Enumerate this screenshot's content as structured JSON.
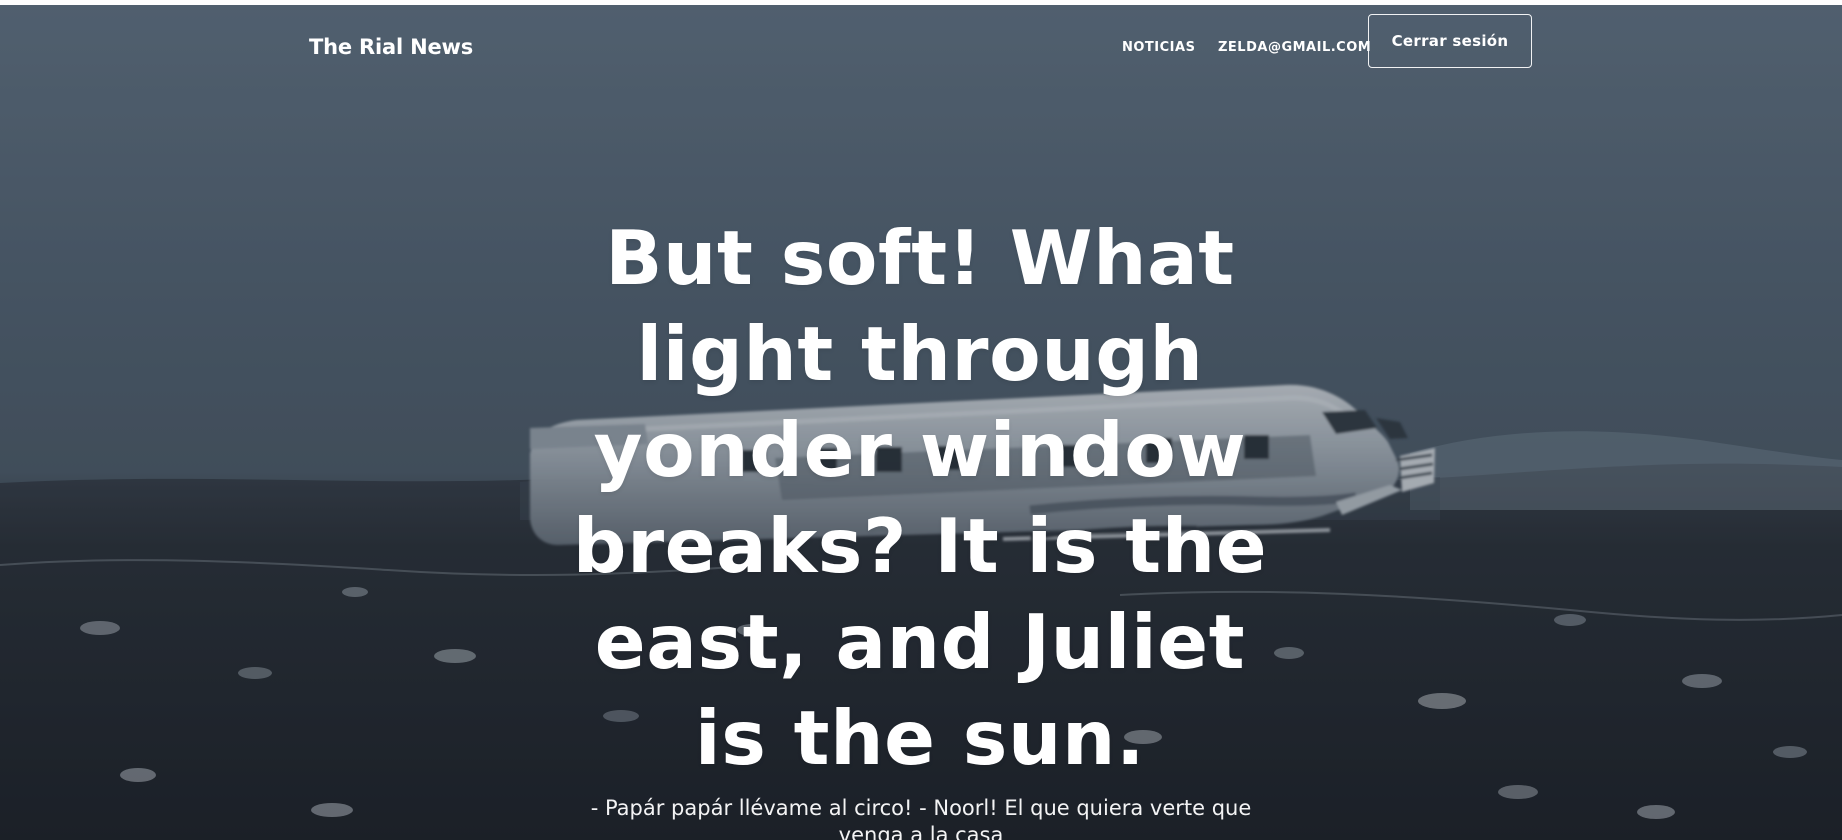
{
  "nav": {
    "brand": "The Rial News",
    "links": [
      "NOTICIAS",
      "ZELDA@GMAIL.COM"
    ],
    "logout_button": "Cerrar sesión"
  },
  "hero": {
    "headline": "But soft! What light through yonder window breaks? It is the east, and Juliet is the sun.",
    "subheading": "- Papár papár llévame al circo! - Noorl! El que quiera verte que venga a la casa"
  },
  "colors": {
    "nav_text": "#ffffff",
    "button_border": "#ffffff",
    "sky": "#5f7080",
    "ground": "#1f242a"
  },
  "icons": {
    "background_image": "crashed-airplane-landscape-photo"
  }
}
